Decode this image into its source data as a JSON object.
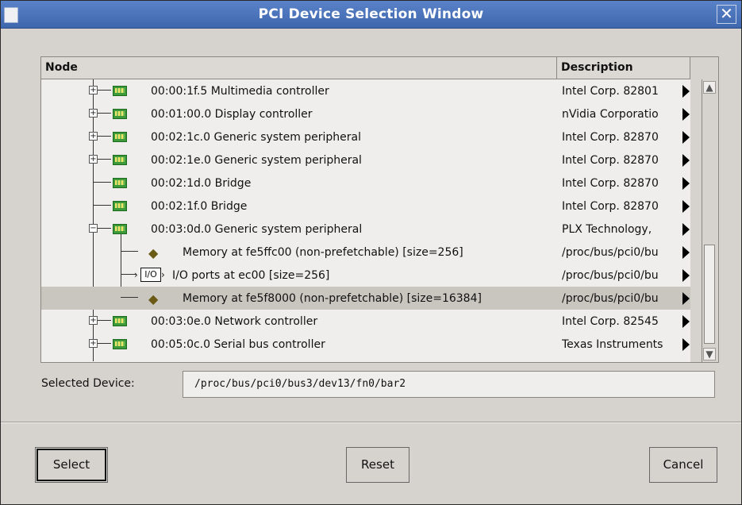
{
  "window": {
    "title": "PCI Device Selection Window"
  },
  "tree": {
    "headers": {
      "node": "Node",
      "description": "Description"
    },
    "rows": [
      {
        "node": "00:00:1f.5 Multimedia controller",
        "desc": "Intel Corp. 82801"
      },
      {
        "node": "00:01:00.0 Display controller",
        "desc": "nVidia Corporatio"
      },
      {
        "node": "00:02:1c.0 Generic system peripheral",
        "desc": "Intel Corp. 82870"
      },
      {
        "node": "00:02:1e.0 Generic system peripheral",
        "desc": "Intel Corp. 82870"
      },
      {
        "node": "00:02:1d.0 Bridge",
        "desc": "Intel Corp. 82870"
      },
      {
        "node": "00:02:1f.0 Bridge",
        "desc": "Intel Corp. 82870"
      },
      {
        "node": "00:03:0d.0 Generic system peripheral",
        "desc": "PLX Technology,"
      },
      {
        "node": "Memory at fe5ffc00 (non-prefetchable) [size=256]",
        "desc": "/proc/bus/pci0/bu"
      },
      {
        "node": "I/O ports at ec00 [size=256]",
        "desc": "/proc/bus/pci0/bu",
        "icon_label": "I/O"
      },
      {
        "node": "Memory at fe5f8000 (non-prefetchable) [size=16384]",
        "desc": "/proc/bus/pci0/bu"
      },
      {
        "node": "00:03:0e.0 Network controller",
        "desc": "Intel Corp. 82545"
      },
      {
        "node": "00:05:0c.0 Serial bus controller",
        "desc": "Texas Instruments"
      }
    ]
  },
  "selected": {
    "label": "Selected Device:",
    "value": "/proc/bus/pci0/bus3/dev13/fn0/bar2"
  },
  "buttons": {
    "select": "Select",
    "reset": "Reset",
    "cancel": "Cancel"
  },
  "icons": {
    "close": "close-icon",
    "expander": "plus-box-icon",
    "device": "pci-card-icon",
    "memory": "memory-chip-icon"
  }
}
